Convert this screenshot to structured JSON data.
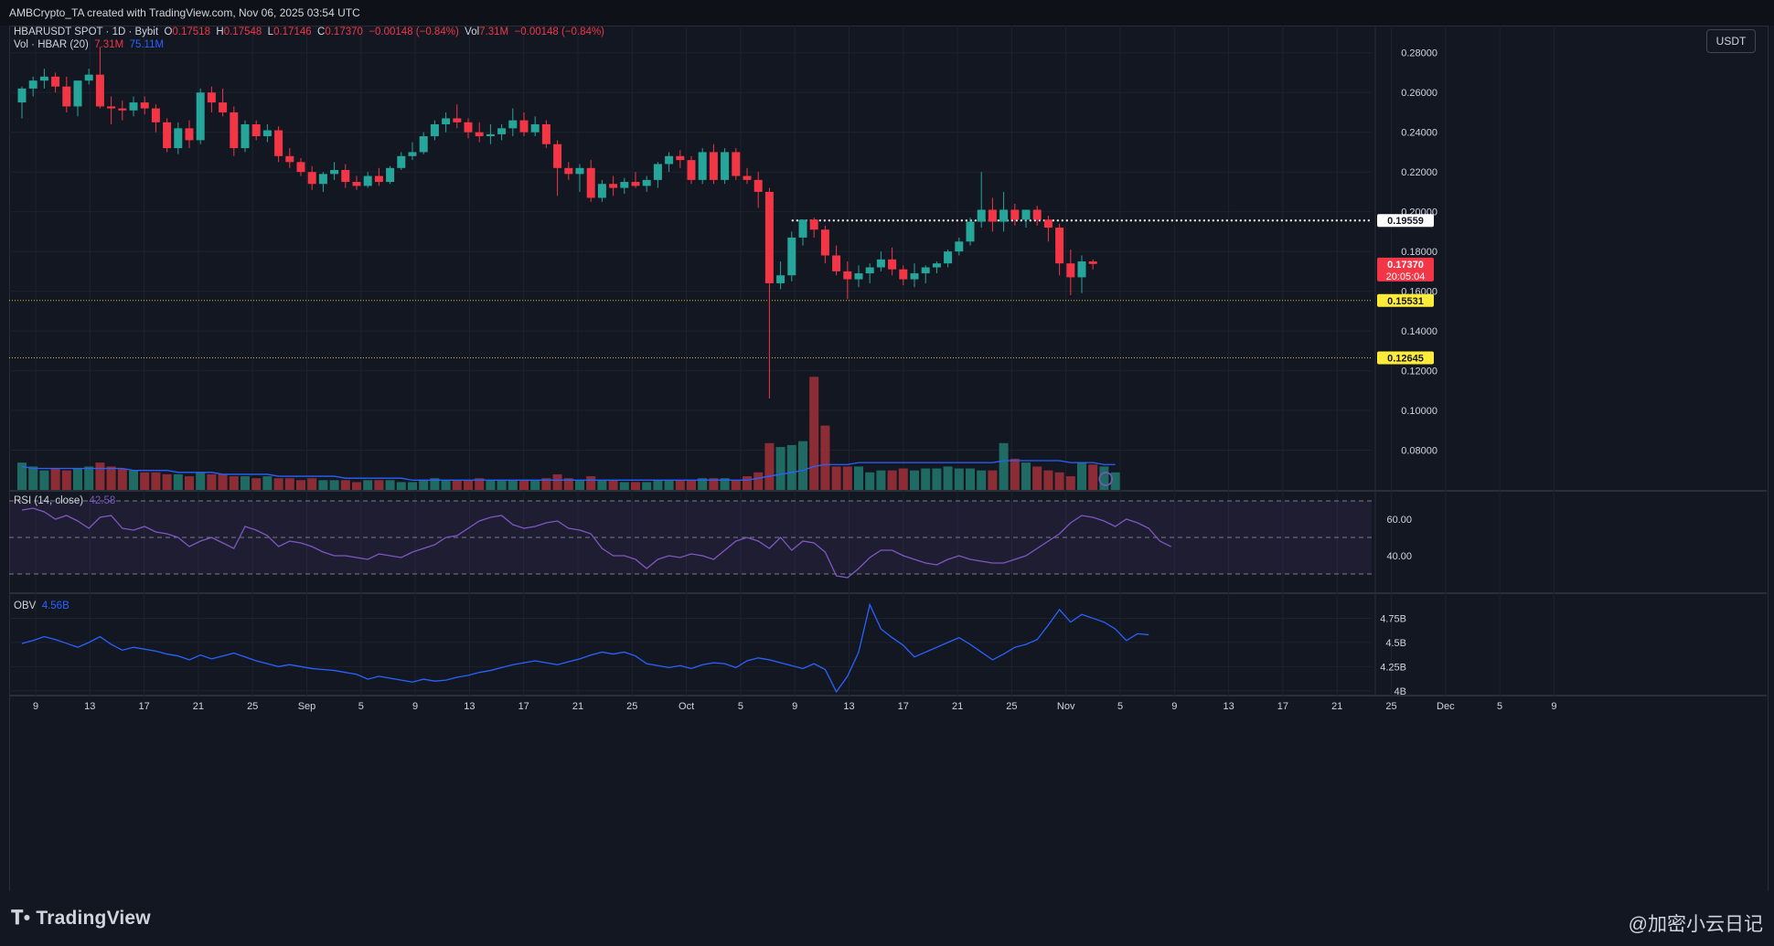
{
  "header": {
    "created_text": "AMBCrypto_TA created with TradingView.com, Nov 06, 2025 03:54 UTC"
  },
  "legend": {
    "symbol": "HBARUSDT SPOT · 1D · Bybit",
    "o_label": "O",
    "o_val": "0.17518",
    "h_label": "H",
    "h_val": "0.17548",
    "l_label": "L",
    "l_val": "0.17146",
    "c_label": "C",
    "c_val": "0.17370",
    "change": "−0.00148 (−0.84%)",
    "vol_label": "Vol",
    "vol_val": "7.31M",
    "vol_change": "−0.00148 (−0.84%)",
    "vol_line": "Vol · HBAR (20)",
    "vol_now": "7.31M",
    "vol_ma": "75.11M",
    "rsi_label": "RSI (14, close)",
    "rsi_val": "42.58",
    "obv_label": "OBV",
    "obv_val": "4.56B"
  },
  "toolbar": {
    "currency": "USDT"
  },
  "footer": {
    "logo_text": "TradingView",
    "watermark": "@加密小云日记"
  },
  "colors": {
    "up": "#26a69a",
    "down": "#f23645",
    "bg": "#131722",
    "grid": "#1e222d",
    "vol_up": "#1f6b63",
    "vol_down": "#8c2d36",
    "vol_ma": "#2962ff",
    "rsi": "#7e57c2",
    "obv": "#2962ff",
    "support": "#ffeb3b"
  },
  "chart_data": {
    "type": "candlestick",
    "price_axis": {
      "ticks": [
        "0.28000",
        "0.26000",
        "0.24000",
        "0.22000",
        "0.20000",
        "0.18000",
        "0.16000",
        "0.14000",
        "0.12000",
        "0.10000",
        "0.08000"
      ],
      "ylim": [
        0.06,
        0.29
      ]
    },
    "price_labels": [
      {
        "value": 0.19559,
        "text": "0.19559",
        "style": "resistance"
      },
      {
        "value": 0.1737,
        "text": "0.17370",
        "sub": "20:05:04",
        "style": "current"
      },
      {
        "value": 0.15531,
        "text": "0.15531",
        "style": "support"
      },
      {
        "value": 0.12645,
        "text": "0.12645",
        "style": "support"
      }
    ],
    "x_ticks": [
      "9",
      "13",
      "17",
      "21",
      "25",
      "Sep",
      "5",
      "9",
      "13",
      "17",
      "21",
      "25",
      "Oct",
      "5",
      "9",
      "13",
      "17",
      "21",
      "25",
      "Nov",
      "5",
      "9",
      "13",
      "17",
      "21",
      "25",
      "Dec",
      "5",
      "9"
    ],
    "candles": [
      [
        0.255,
        0.263,
        0.247,
        0.262
      ],
      [
        0.262,
        0.268,
        0.258,
        0.266
      ],
      [
        0.266,
        0.272,
        0.262,
        0.268
      ],
      [
        0.268,
        0.27,
        0.26,
        0.263
      ],
      [
        0.263,
        0.268,
        0.25,
        0.253
      ],
      [
        0.253,
        0.262,
        0.248,
        0.266
      ],
      [
        0.266,
        0.272,
        0.264,
        0.269
      ],
      [
        0.269,
        0.283,
        0.252,
        0.253
      ],
      [
        0.253,
        0.258,
        0.244,
        0.252
      ],
      [
        0.252,
        0.256,
        0.246,
        0.251
      ],
      [
        0.251,
        0.258,
        0.248,
        0.255
      ],
      [
        0.255,
        0.258,
        0.249,
        0.252
      ],
      [
        0.252,
        0.254,
        0.24,
        0.245
      ],
      [
        0.245,
        0.247,
        0.23,
        0.232
      ],
      [
        0.232,
        0.245,
        0.229,
        0.242
      ],
      [
        0.242,
        0.246,
        0.232,
        0.236
      ],
      [
        0.236,
        0.262,
        0.234,
        0.26
      ],
      [
        0.26,
        0.263,
        0.25,
        0.255
      ],
      [
        0.255,
        0.262,
        0.248,
        0.25
      ],
      [
        0.25,
        0.253,
        0.228,
        0.232
      ],
      [
        0.232,
        0.246,
        0.23,
        0.244
      ],
      [
        0.244,
        0.246,
        0.236,
        0.238
      ],
      [
        0.238,
        0.244,
        0.235,
        0.241
      ],
      [
        0.241,
        0.243,
        0.225,
        0.228
      ],
      [
        0.228,
        0.232,
        0.222,
        0.225
      ],
      [
        0.225,
        0.227,
        0.218,
        0.22
      ],
      [
        0.22,
        0.223,
        0.211,
        0.214
      ],
      [
        0.214,
        0.22,
        0.21,
        0.219
      ],
      [
        0.219,
        0.225,
        0.216,
        0.221
      ],
      [
        0.221,
        0.224,
        0.212,
        0.215
      ],
      [
        0.215,
        0.218,
        0.211,
        0.213
      ],
      [
        0.213,
        0.22,
        0.212,
        0.218
      ],
      [
        0.218,
        0.222,
        0.213,
        0.215
      ],
      [
        0.215,
        0.223,
        0.214,
        0.222
      ],
      [
        0.222,
        0.23,
        0.221,
        0.228
      ],
      [
        0.228,
        0.235,
        0.226,
        0.23
      ],
      [
        0.23,
        0.24,
        0.229,
        0.238
      ],
      [
        0.238,
        0.246,
        0.236,
        0.244
      ],
      [
        0.244,
        0.25,
        0.24,
        0.247
      ],
      [
        0.247,
        0.254,
        0.242,
        0.245
      ],
      [
        0.245,
        0.247,
        0.237,
        0.24
      ],
      [
        0.24,
        0.245,
        0.235,
        0.238
      ],
      [
        0.238,
        0.244,
        0.234,
        0.239
      ],
      [
        0.239,
        0.244,
        0.236,
        0.242
      ],
      [
        0.242,
        0.252,
        0.238,
        0.246
      ],
      [
        0.246,
        0.25,
        0.238,
        0.24
      ],
      [
        0.24,
        0.248,
        0.238,
        0.244
      ],
      [
        0.244,
        0.246,
        0.232,
        0.234
      ],
      [
        0.234,
        0.236,
        0.208,
        0.222
      ],
      [
        0.222,
        0.225,
        0.216,
        0.219
      ],
      [
        0.219,
        0.224,
        0.21,
        0.222
      ],
      [
        0.222,
        0.226,
        0.205,
        0.207
      ],
      [
        0.207,
        0.216,
        0.205,
        0.214
      ],
      [
        0.214,
        0.218,
        0.208,
        0.212
      ],
      [
        0.212,
        0.217,
        0.209,
        0.215
      ],
      [
        0.215,
        0.22,
        0.212,
        0.213
      ],
      [
        0.213,
        0.218,
        0.21,
        0.216
      ],
      [
        0.216,
        0.225,
        0.212,
        0.224
      ],
      [
        0.224,
        0.23,
        0.22,
        0.228
      ],
      [
        0.228,
        0.231,
        0.222,
        0.226
      ],
      [
        0.226,
        0.228,
        0.214,
        0.216
      ],
      [
        0.216,
        0.232,
        0.214,
        0.23
      ],
      [
        0.23,
        0.234,
        0.214,
        0.216
      ],
      [
        0.216,
        0.232,
        0.214,
        0.23
      ],
      [
        0.23,
        0.232,
        0.216,
        0.218
      ],
      [
        0.218,
        0.222,
        0.214,
        0.216
      ],
      [
        0.216,
        0.22,
        0.202,
        0.21
      ],
      [
        0.21,
        0.212,
        0.106,
        0.164
      ],
      [
        0.164,
        0.175,
        0.161,
        0.168
      ],
      [
        0.168,
        0.19,
        0.165,
        0.187
      ],
      [
        0.187,
        0.196,
        0.183,
        0.196
      ],
      [
        0.196,
        0.197,
        0.187,
        0.191
      ],
      [
        0.191,
        0.193,
        0.174,
        0.178
      ],
      [
        0.178,
        0.183,
        0.168,
        0.17
      ],
      [
        0.17,
        0.175,
        0.156,
        0.166
      ],
      [
        0.166,
        0.173,
        0.162,
        0.169
      ],
      [
        0.169,
        0.174,
        0.164,
        0.172
      ],
      [
        0.172,
        0.18,
        0.17,
        0.176
      ],
      [
        0.176,
        0.182,
        0.168,
        0.171
      ],
      [
        0.171,
        0.173,
        0.163,
        0.166
      ],
      [
        0.166,
        0.174,
        0.162,
        0.169
      ],
      [
        0.169,
        0.173,
        0.164,
        0.172
      ],
      [
        0.172,
        0.175,
        0.169,
        0.174
      ],
      [
        0.174,
        0.181,
        0.172,
        0.18
      ],
      [
        0.18,
        0.187,
        0.178,
        0.185
      ],
      [
        0.185,
        0.197,
        0.183,
        0.195
      ],
      [
        0.195,
        0.22,
        0.192,
        0.201
      ],
      [
        0.201,
        0.207,
        0.19,
        0.195
      ],
      [
        0.195,
        0.21,
        0.19,
        0.201
      ],
      [
        0.201,
        0.204,
        0.193,
        0.196
      ],
      [
        0.196,
        0.201,
        0.192,
        0.201
      ],
      [
        0.201,
        0.203,
        0.193,
        0.196
      ],
      [
        0.196,
        0.198,
        0.185,
        0.192
      ],
      [
        0.192,
        0.194,
        0.168,
        0.174
      ],
      [
        0.174,
        0.181,
        0.158,
        0.167
      ],
      [
        0.167,
        0.178,
        0.159,
        0.175
      ],
      [
        0.175,
        0.176,
        0.171,
        0.1737
      ]
    ],
    "volume_scale": [
      0,
      60
    ],
    "volume": [
      14,
      12,
      10,
      11,
      10,
      11,
      12,
      14,
      12,
      11,
      10,
      9,
      9,
      8,
      8,
      7,
      9,
      8,
      8,
      7,
      7,
      6,
      7,
      6,
      6,
      5,
      6,
      5,
      5,
      5,
      4,
      5,
      5,
      5,
      4,
      4,
      5,
      6,
      5,
      5,
      5,
      6,
      5,
      5,
      5,
      5,
      5,
      6,
      8,
      6,
      5,
      7,
      5,
      5,
      4,
      4,
      4,
      5,
      5,
      5,
      5,
      6,
      6,
      6,
      5,
      7,
      9,
      24,
      22,
      23,
      25,
      58,
      33,
      12,
      12,
      12,
      9,
      10,
      10,
      11,
      10,
      11,
      11,
      12,
      11,
      11,
      10,
      10,
      24,
      16,
      14,
      12,
      10,
      9,
      7,
      14,
      13,
      12,
      9
    ],
    "volume_ma": [
      12,
      11,
      11,
      11,
      11,
      11,
      11,
      11,
      11,
      11,
      10,
      10,
      10,
      10,
      9,
      9,
      9,
      9,
      8,
      8,
      8,
      8,
      8,
      7,
      7,
      7,
      7,
      7,
      7,
      6,
      6,
      6,
      6,
      6,
      6,
      5,
      5,
      5,
      5,
      5,
      5,
      5,
      5,
      5,
      5,
      5,
      5,
      5,
      5,
      5,
      5,
      5,
      5,
      5,
      5,
      5,
      5,
      5,
      5,
      5,
      5,
      5,
      5,
      5,
      5,
      5,
      6,
      7,
      8,
      9,
      10,
      12,
      13,
      13,
      13,
      14,
      14,
      14,
      14,
      14,
      14,
      14,
      14,
      14,
      14,
      14,
      14,
      14,
      15,
      15,
      15,
      15,
      15,
      15,
      14,
      14,
      14,
      13,
      13
    ],
    "rsi_axis": {
      "ticks": [
        "60.00",
        "40.00"
      ],
      "ylim": [
        20,
        75
      ]
    },
    "rsi": [
      65,
      66,
      64,
      60,
      62,
      59,
      55,
      61,
      62,
      55,
      54,
      56,
      53,
      52,
      50,
      45,
      48,
      50,
      47,
      44,
      56,
      54,
      51,
      45,
      48,
      47,
      45,
      42,
      40,
      40,
      39,
      38,
      41,
      40,
      39,
      42,
      44,
      46,
      50,
      51,
      55,
      59,
      61,
      62,
      57,
      55,
      56,
      58,
      59,
      55,
      54,
      52,
      44,
      40,
      40,
      38,
      33,
      38,
      40,
      39,
      41,
      40,
      38,
      43,
      48,
      50,
      48,
      44,
      50,
      43,
      48,
      47,
      42,
      29,
      28,
      33,
      39,
      43,
      43,
      40,
      38,
      36,
      35,
      38,
      40,
      38,
      37,
      36,
      36,
      38,
      40,
      44,
      48,
      52,
      58,
      62,
      61,
      59,
      56,
      60,
      58,
      55,
      48,
      45
    ],
    "obv_axis": {
      "ticks": [
        "4.75B",
        "4.5B",
        "4.25B",
        "4B"
      ],
      "ylim": [
        3.96,
        5.0
      ]
    },
    "obv": [
      4.49,
      4.52,
      4.56,
      4.53,
      4.49,
      4.45,
      4.5,
      4.56,
      4.48,
      4.42,
      4.45,
      4.43,
      4.41,
      4.38,
      4.36,
      4.32,
      4.37,
      4.33,
      4.36,
      4.39,
      4.35,
      4.31,
      4.28,
      4.25,
      4.27,
      4.25,
      4.23,
      4.22,
      4.21,
      4.19,
      4.17,
      4.12,
      4.15,
      4.13,
      4.11,
      4.09,
      4.12,
      4.1,
      4.11,
      4.14,
      4.16,
      4.19,
      4.21,
      4.24,
      4.27,
      4.29,
      4.31,
      4.29,
      4.27,
      4.3,
      4.33,
      4.37,
      4.4,
      4.38,
      4.4,
      4.36,
      4.28,
      4.26,
      4.24,
      4.26,
      4.23,
      4.27,
      4.29,
      4.28,
      4.24,
      4.31,
      4.34,
      4.32,
      4.29,
      4.26,
      4.23,
      4.28,
      4.22,
      3.99,
      4.15,
      4.4,
      4.89,
      4.64,
      4.55,
      4.47,
      4.35,
      4.4,
      4.45,
      4.5,
      4.55,
      4.48,
      4.4,
      4.32,
      4.38,
      4.45,
      4.48,
      4.53,
      4.68,
      4.84,
      4.71,
      4.79,
      4.75,
      4.71,
      4.64,
      4.52,
      4.59,
      4.58
    ]
  }
}
